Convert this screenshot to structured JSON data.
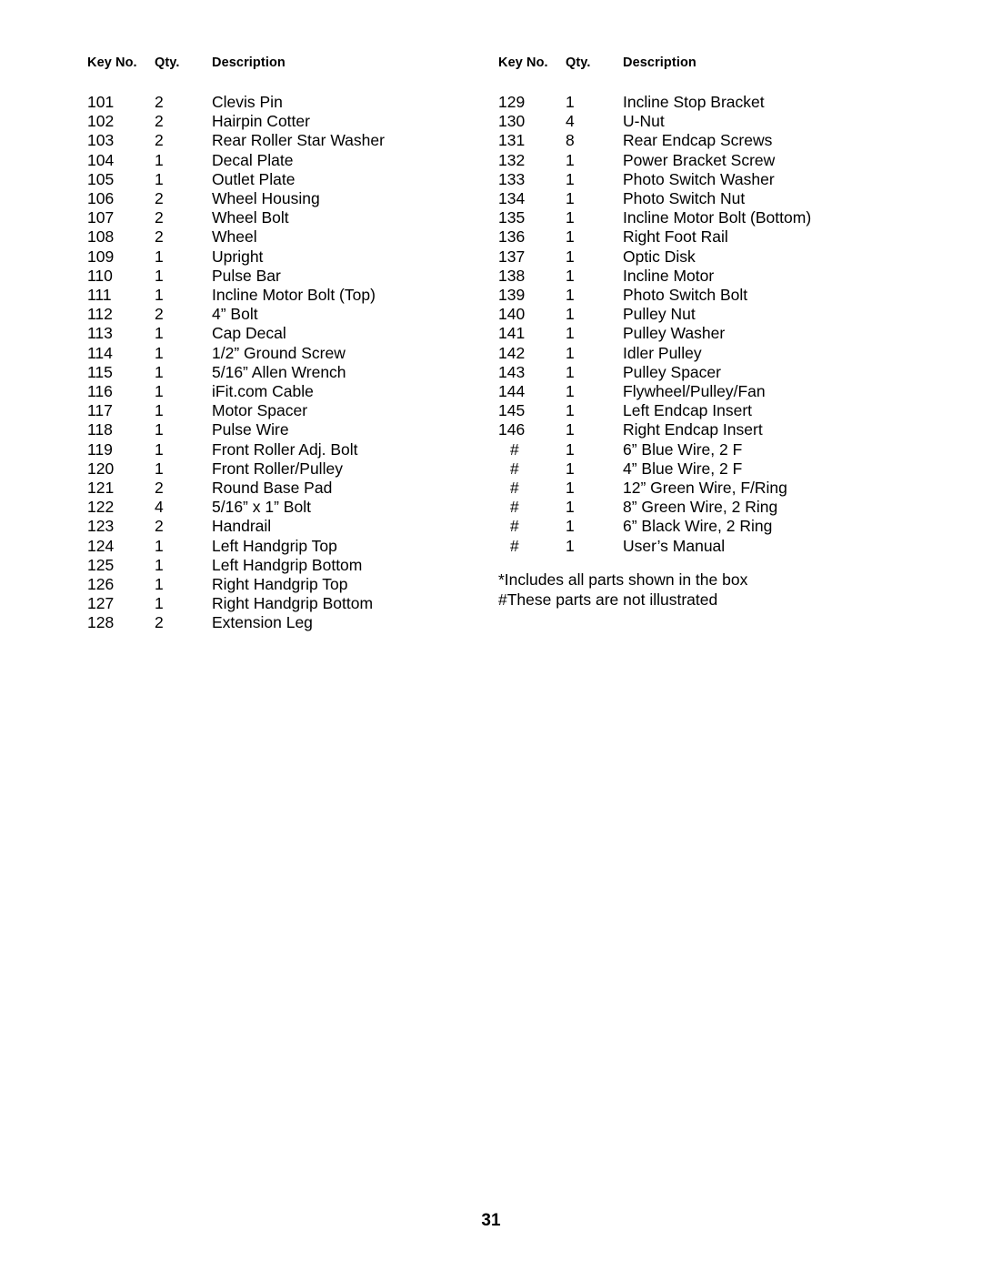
{
  "page": {
    "number": "31",
    "background_color": "#ffffff",
    "text_color": "#000000"
  },
  "table_headers": {
    "key_no": "Key No.",
    "qty": "Qty.",
    "description": "Description"
  },
  "left_column": {
    "rows": [
      {
        "key": "101",
        "qty": "2",
        "description": "Clevis Pin"
      },
      {
        "key": "102",
        "qty": "2",
        "description": "Hairpin Cotter"
      },
      {
        "key": "103",
        "qty": "2",
        "description": "Rear Roller Star Washer"
      },
      {
        "key": "104",
        "qty": "1",
        "description": "Decal Plate"
      },
      {
        "key": "105",
        "qty": "1",
        "description": "Outlet Plate"
      },
      {
        "key": "106",
        "qty": "2",
        "description": "Wheel Housing"
      },
      {
        "key": "107",
        "qty": "2",
        "description": "Wheel Bolt"
      },
      {
        "key": "108",
        "qty": "2",
        "description": "Wheel"
      },
      {
        "key": "109",
        "qty": "1",
        "description": "Upright"
      },
      {
        "key": "110",
        "qty": "1",
        "description": "Pulse Bar"
      },
      {
        "key": "111",
        "qty": "1",
        "description": "Incline Motor Bolt (Top)"
      },
      {
        "key": "112",
        "qty": "2",
        "description": "4” Bolt"
      },
      {
        "key": "113",
        "qty": "1",
        "description": "Cap Decal"
      },
      {
        "key": "114",
        "qty": "1",
        "description": "1/2” Ground Screw"
      },
      {
        "key": "115",
        "qty": "1",
        "description": "5/16” Allen Wrench"
      },
      {
        "key": "116",
        "qty": "1",
        "description": "iFit.com Cable"
      },
      {
        "key": "117",
        "qty": "1",
        "description": "Motor Spacer"
      },
      {
        "key": "118",
        "qty": "1",
        "description": "Pulse Wire"
      },
      {
        "key": "119",
        "qty": "1",
        "description": "Front Roller Adj. Bolt"
      },
      {
        "key": "120",
        "qty": "1",
        "description": "Front Roller/Pulley"
      },
      {
        "key": "121",
        "qty": "2",
        "description": "Round Base Pad"
      },
      {
        "key": "122",
        "qty": "4",
        "description": "5/16” x 1” Bolt"
      },
      {
        "key": "123",
        "qty": "2",
        "description": "Handrail"
      },
      {
        "key": "124",
        "qty": "1",
        "description": "Left Handgrip Top"
      },
      {
        "key": "125",
        "qty": "1",
        "description": "Left Handgrip Bottom"
      },
      {
        "key": "126",
        "qty": "1",
        "description": "Right Handgrip Top"
      },
      {
        "key": "127",
        "qty": "1",
        "description": "Right Handgrip Bottom"
      },
      {
        "key": "128",
        "qty": "2",
        "description": "Extension Leg"
      }
    ]
  },
  "right_column": {
    "rows": [
      {
        "key": "129",
        "qty": "1",
        "description": "Incline Stop Bracket"
      },
      {
        "key": "130",
        "qty": "4",
        "description": "U-Nut"
      },
      {
        "key": "131",
        "qty": "8",
        "description": "Rear Endcap Screws"
      },
      {
        "key": "132",
        "qty": "1",
        "description": "Power Bracket Screw"
      },
      {
        "key": "133",
        "qty": "1",
        "description": "Photo Switch Washer"
      },
      {
        "key": "134",
        "qty": "1",
        "description": "Photo Switch Nut"
      },
      {
        "key": "135",
        "qty": "1",
        "description": "Incline Motor Bolt (Bottom)"
      },
      {
        "key": "136",
        "qty": "1",
        "description": "Right Foot Rail"
      },
      {
        "key": "137",
        "qty": "1",
        "description": "Optic Disk"
      },
      {
        "key": "138",
        "qty": "1",
        "description": "Incline Motor"
      },
      {
        "key": "139",
        "qty": "1",
        "description": "Photo Switch Bolt"
      },
      {
        "key": "140",
        "qty": "1",
        "description": "Pulley Nut"
      },
      {
        "key": "141",
        "qty": "1",
        "description": "Pulley Washer"
      },
      {
        "key": "142",
        "qty": "1",
        "description": "Idler Pulley"
      },
      {
        "key": "143",
        "qty": "1",
        "description": "Pulley Spacer"
      },
      {
        "key": "144",
        "qty": "1",
        "description": "Flywheel/Pulley/Fan"
      },
      {
        "key": "145",
        "qty": "1",
        "description": "Left Endcap Insert"
      },
      {
        "key": "146",
        "qty": "1",
        "description": "Right Endcap Insert"
      },
      {
        "key": "#",
        "qty": "1",
        "description": "6” Blue Wire, 2 F"
      },
      {
        "key": "#",
        "qty": "1",
        "description": "4” Blue Wire, 2 F"
      },
      {
        "key": "#",
        "qty": "1",
        "description": "12” Green Wire, F/Ring"
      },
      {
        "key": "#",
        "qty": "1",
        "description": "8” Green Wire, 2 Ring"
      },
      {
        "key": "#",
        "qty": "1",
        "description": "6” Black Wire, 2 Ring"
      },
      {
        "key": "#",
        "qty": "1",
        "description": "User’s Manual"
      }
    ]
  },
  "footnotes": [
    "*Includes all parts shown in the box",
    "#These parts are not illustrated"
  ]
}
